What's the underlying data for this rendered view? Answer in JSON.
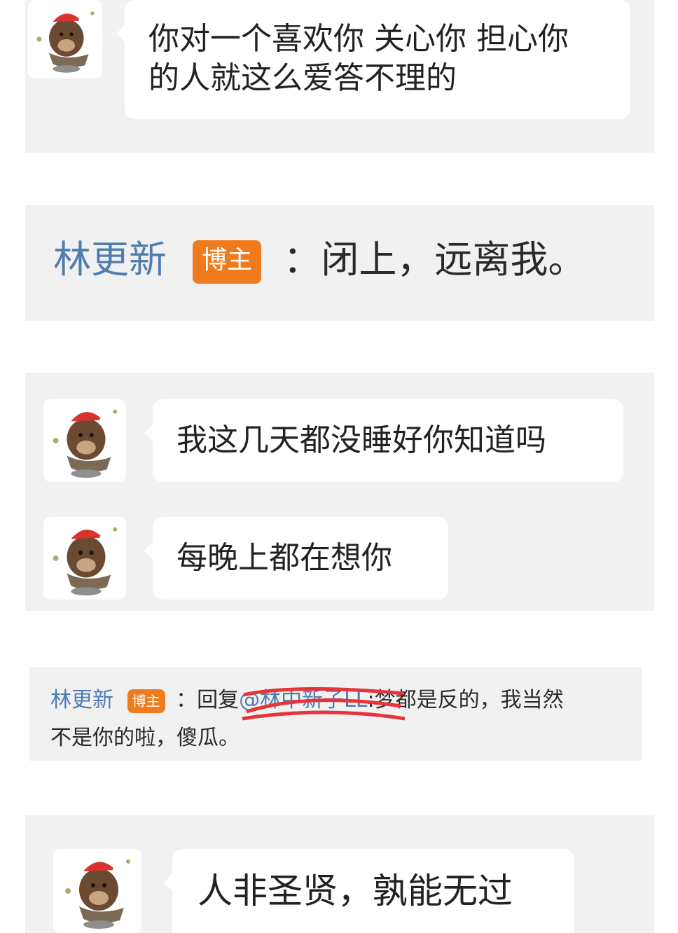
{
  "messages": [
    {
      "text_line1": "你对一个喜欢你 关心你 担心你",
      "text_line2": "的人就这么爱答不理的"
    },
    {
      "text": "我这几天都没睡好你知道吗"
    },
    {
      "text": "每晚上都在想你"
    },
    {
      "text": "人非圣贤，孰能无过"
    }
  ],
  "replies": [
    {
      "author": "林更新",
      "badge": "博主",
      "separator": "：",
      "text": "闭上，远离我。"
    },
    {
      "author": "林更新",
      "badge": "博主",
      "separator": "：",
      "reply_prefix": "回复",
      "mention": "@林中新子LL",
      "text_line1_tail": ":梦都是反的，我当然",
      "text_line2": "不是你的啦，傻瓜。"
    }
  ],
  "colors": {
    "panel_bg": "#f1f1f2",
    "name": "#4f7db1",
    "badge_bg": "#f07b1e",
    "redaction": "#e5343a"
  },
  "icons": {
    "avatar": "brown-bear-santa-hat-sticker"
  }
}
